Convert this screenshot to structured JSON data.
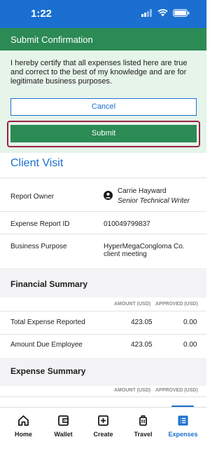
{
  "status_bar": {
    "time": "1:22"
  },
  "confirmation": {
    "header": "Submit Confirmation",
    "text": "I hereby certify that all expenses listed here are true and correct to the best of my knowledge and are for legitimate business purposes.",
    "cancel_label": "Cancel",
    "submit_label": "Submit"
  },
  "report": {
    "title": "Client Visit",
    "owner_label": "Report Owner",
    "owner_name": "Carrie Hayward",
    "owner_role": "Senior Technical Writer",
    "id_label": "Expense Report ID",
    "id_value": "010049799837",
    "purpose_label": "Business Purpose",
    "purpose_line1": "HyperMegaCongloma Co.",
    "purpose_line2": "client meeting"
  },
  "financial_summary": {
    "title": "Financial Summary",
    "col_amount": "AMOUNT (USD)",
    "col_approved": "APPROVED (USD)",
    "rows": [
      {
        "label": "Total Expense Reported",
        "amount": "423.05",
        "approved": "0.00"
      },
      {
        "label": "Amount Due Employee",
        "amount": "423.05",
        "approved": "0.00"
      }
    ]
  },
  "expense_summary": {
    "title": "Expense Summary",
    "col_amount": "AMOUNT (USD)",
    "col_approved": "APPROVED (USD)"
  },
  "nav": {
    "items": [
      {
        "label": "Home",
        "icon": "home-icon"
      },
      {
        "label": "Wallet",
        "icon": "wallet-icon"
      },
      {
        "label": "Create",
        "icon": "plus-square-icon"
      },
      {
        "label": "Travel",
        "icon": "luggage-icon"
      },
      {
        "label": "Expenses",
        "icon": "list-icon",
        "active": true
      }
    ],
    "active_color": "#1a6fd0"
  },
  "colors": {
    "brand_blue": "#1a6fd0",
    "confirm_green": "#2c8a55",
    "highlight_border": "#9b2441"
  }
}
